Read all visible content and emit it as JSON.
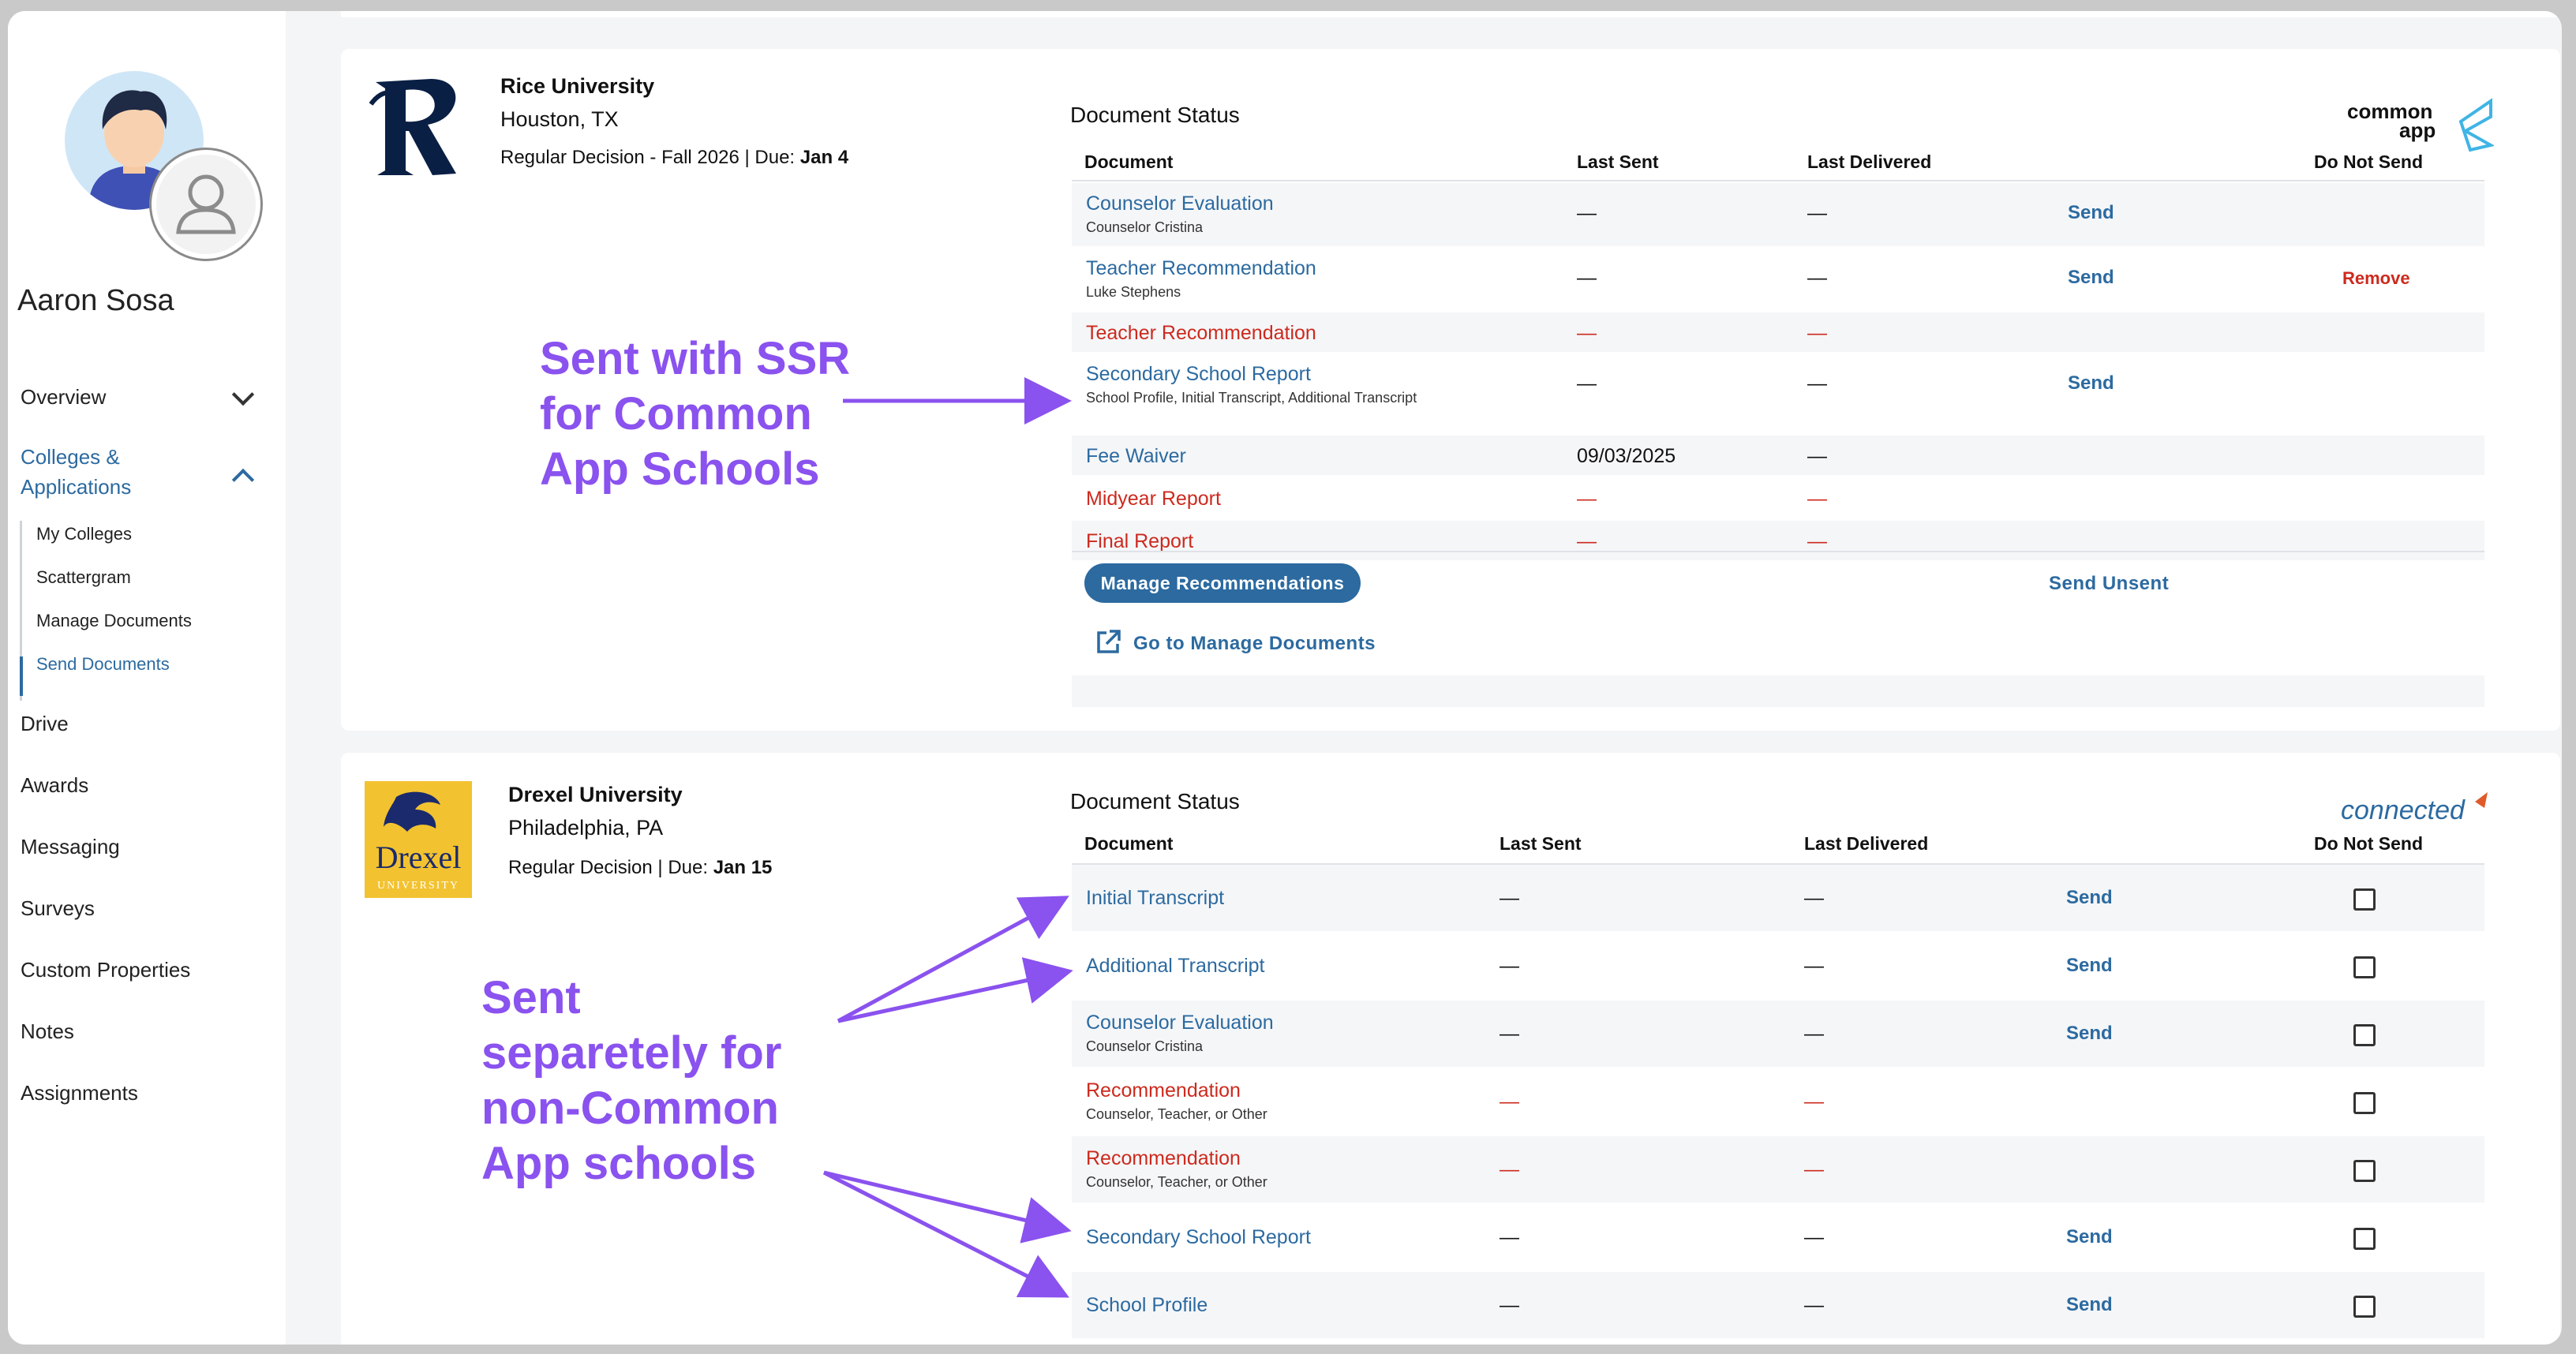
{
  "user": {
    "name": "Aaron Sosa"
  },
  "nav": {
    "overview": "Overview",
    "colleges": "Colleges &",
    "colleges2": "Applications",
    "sub": [
      "My Colleges",
      "Scattergram",
      "Manage Documents",
      "Send Documents"
    ],
    "items": [
      "Drive",
      "Awards",
      "Messaging",
      "Surveys",
      "Custom Properties",
      "Notes",
      "Assignments"
    ]
  },
  "rice": {
    "name": "Rice University",
    "location": "Houston, TX",
    "deadline_prefix": "Regular Decision - Fall 2026 | Due: ",
    "deadline_date": "Jan 4",
    "status_title": "Document Status",
    "platform": "common app",
    "headers": {
      "document": "Document",
      "last_sent": "Last Sent",
      "last_delivered": "Last Delivered",
      "do_not_send": "Do Not Send"
    },
    "rows": [
      {
        "name": "Counselor Evaluation",
        "sub": "Counselor Cristina",
        "sent": "—",
        "delivered": "—",
        "action": "Send",
        "dns": ""
      },
      {
        "name": "Teacher Recommendation",
        "sub": "Luke Stephens",
        "sent": "—",
        "delivered": "—",
        "action": "Send",
        "dns": "Remove"
      },
      {
        "name": "Teacher Recommendation",
        "sub": "",
        "sent": "—",
        "delivered": "—",
        "action": "",
        "dns": ""
      },
      {
        "name": "Secondary School Report",
        "sub": "School Profile, Initial Transcript, Additional Transcript",
        "sent": "—",
        "delivered": "—",
        "action": "Send",
        "dns": ""
      },
      {
        "name": "Fee Waiver",
        "sub": "",
        "sent": "09/03/2025",
        "delivered": "—",
        "action": "",
        "dns": ""
      },
      {
        "name": "Midyear Report",
        "sub": "",
        "sent": "—",
        "delivered": "—",
        "action": "",
        "dns": ""
      },
      {
        "name": "Final Report",
        "sub": "",
        "sent": "—",
        "delivered": "—",
        "action": "",
        "dns": ""
      }
    ],
    "manage_btn": "Manage Recommendations",
    "send_unsent": "Send Unsent",
    "go_manage": "Go to Manage Documents"
  },
  "drexel": {
    "name": "Drexel University",
    "location": "Philadelphia, PA",
    "deadline_prefix": "Regular Decision | Due: ",
    "deadline_date": "Jan 15",
    "logo_word": "Drexel",
    "logo_sub": "UNIVERSITY",
    "status_title": "Document Status",
    "platform": "connected",
    "headers": {
      "document": "Document",
      "last_sent": "Last Sent",
      "last_delivered": "Last Delivered",
      "do_not_send": "Do Not Send"
    },
    "rows": [
      {
        "name": "Initial Transcript",
        "sub": "",
        "sent": "—",
        "delivered": "—",
        "action": "Send"
      },
      {
        "name": "Additional Transcript",
        "sub": "",
        "sent": "—",
        "delivered": "—",
        "action": "Send"
      },
      {
        "name": "Counselor Evaluation",
        "sub": "Counselor Cristina",
        "sent": "—",
        "delivered": "—",
        "action": "Send"
      },
      {
        "name": "Recommendation",
        "sub": "Counselor, Teacher, or Other",
        "sent": "—",
        "delivered": "—",
        "action": ""
      },
      {
        "name": "Recommendation",
        "sub": "Counselor, Teacher, or Other",
        "sent": "—",
        "delivered": "—",
        "action": ""
      },
      {
        "name": "Secondary School Report",
        "sub": "",
        "sent": "—",
        "delivered": "—",
        "action": "Send"
      },
      {
        "name": "School Profile",
        "sub": "",
        "sent": "—",
        "delivered": "—",
        "action": "Send"
      }
    ]
  },
  "annotations": {
    "common": [
      "Sent with SSR",
      "for Common",
      "App Schools"
    ],
    "noncommon": [
      "Sent",
      "separetely for",
      "non-Common",
      "App schools"
    ]
  },
  "colors": {
    "accent": "#2c6aa0",
    "danger": "#cc2a1e",
    "annotation": "#8a52ee"
  },
  "icons": [
    "user-avatar-icon",
    "user-profile-badge-icon",
    "chevron-down-icon",
    "chevron-up-icon",
    "external-link-icon",
    "checkbox-icon"
  ]
}
